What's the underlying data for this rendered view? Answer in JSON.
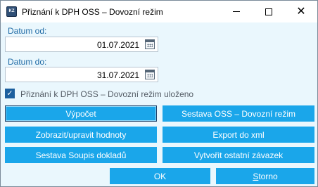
{
  "window": {
    "title": "Přiznání k DPH OSS – Dovozní režim",
    "app_icon_text": "KZ"
  },
  "controls": {
    "minimize": "minimize",
    "maximize": "maximize",
    "close": "✕"
  },
  "form": {
    "date_from_label": "Datum od:",
    "date_from_value": "01.07.2021",
    "date_to_label": "Datum do:",
    "date_to_value": "31.07.2021",
    "saved_checkbox_label": "Přiznání k DPH OSS – Dovozní režim uloženo",
    "saved_checked": true
  },
  "buttons": {
    "vypocet": "Výpočet",
    "sestava_oss": "Sestava OSS – Dovozní režim",
    "zobrazit": "Zobrazit/upravit hodnoty",
    "export": "Export do xml",
    "sestava_soupis": "Sestava Soupis dokladů",
    "vytvorit": "Vytvořit ostatní závazek",
    "ok": "OK",
    "storno_first": "S",
    "storno_rest": "torno"
  },
  "colors": {
    "button_bg": "#1aa6ea",
    "dialog_bg": "#eaf7fd",
    "label_color": "#1f6aa5",
    "checkbox_color": "#1c5f9e"
  }
}
